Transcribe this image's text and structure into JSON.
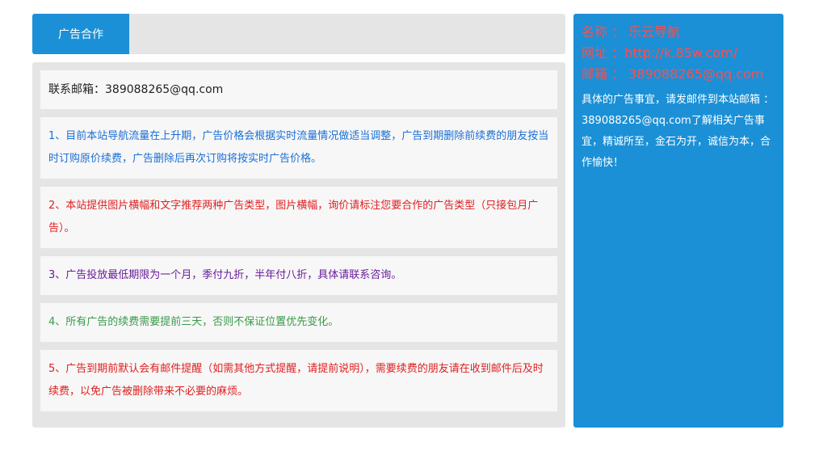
{
  "tabs": {
    "active_label": "广告合作"
  },
  "contact": {
    "email_line": "联系邮箱：389088265@qq.com"
  },
  "notices": [
    "1、目前本站导航流量在上升期，广告价格会根据实时流量情况做适当调整，广告到期删除前续费的朋友按当时订购原价续费，广告删除后再次订购将按实时广告价格。",
    "2、本站提供图片横幅和文字推荐两种广告类型，图片横幅，询价请标注您要合作的广告类型（只接包月广告）。",
    "3、广告投放最低期限为一个月，季付九折，半年付八折，具体请联系咨询。",
    "4、所有广告的续费需要提前三天，否则不保证位置优先变化。",
    "5、广告到期前默认会有邮件提醒（如需其他方式提醒，请提前说明），需要续费的朋友请在收到邮件后及时续费，以免广告被删除带来不必要的麻烦。"
  ],
  "sidebar": {
    "name_line": "名称 ： 乐云导航",
    "url_line": "网址 ：http://k.85w.com/",
    "mail_line": "邮箱 ： 389088265@qq.com",
    "description": "具体的广告事宜，请发邮件到本站邮箱 ： 389088265@qq.com了解相关广告事宜，精诚所至，金石为开，诚信为本，合作愉快！"
  },
  "colors": {
    "accent": "#1b90d6",
    "notice_1": "#1b6fd6",
    "notice_2": "#e02020",
    "notice_3": "#6a1c9a",
    "notice_4": "#3a9a4a",
    "notice_5": "#e02020",
    "sidebar_highlight": "#ff4d4d"
  }
}
